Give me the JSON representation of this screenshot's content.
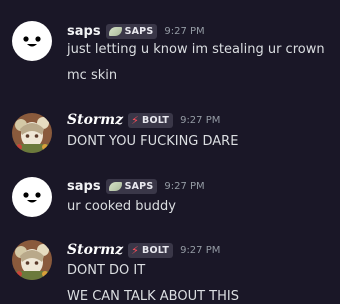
{
  "messages": [
    {
      "username": "saps",
      "tag_icon": "leaf-icon",
      "tag": "SAPS",
      "timestamp": "9:27 PM",
      "lines": [
        "just letting u know im stealing ur crown",
        "mc skin"
      ]
    },
    {
      "username": "Stormz",
      "tag_icon": "lightning-bolt-icon",
      "tag": "BOLT",
      "timestamp": "9:27 PM",
      "lines": [
        "DONT YOU FUCKING DARE"
      ]
    },
    {
      "username": "saps",
      "tag_icon": "leaf-icon",
      "tag": "SAPS",
      "timestamp": "9:27 PM",
      "lines": [
        "ur cooked buddy"
      ]
    },
    {
      "username": "Stormz",
      "tag_icon": "lightning-bolt-icon",
      "tag": "BOLT",
      "timestamp": "9:27 PM",
      "lines": [
        "DONT DO IT",
        "WE CAN TALK ABOUT THIS"
      ]
    }
  ],
  "colors": {
    "background": "#1a1727",
    "text": "#dbdee1",
    "timestamp": "#949ba4",
    "tag_bg": "#3a3748",
    "bolt": "#ff4d5a"
  }
}
